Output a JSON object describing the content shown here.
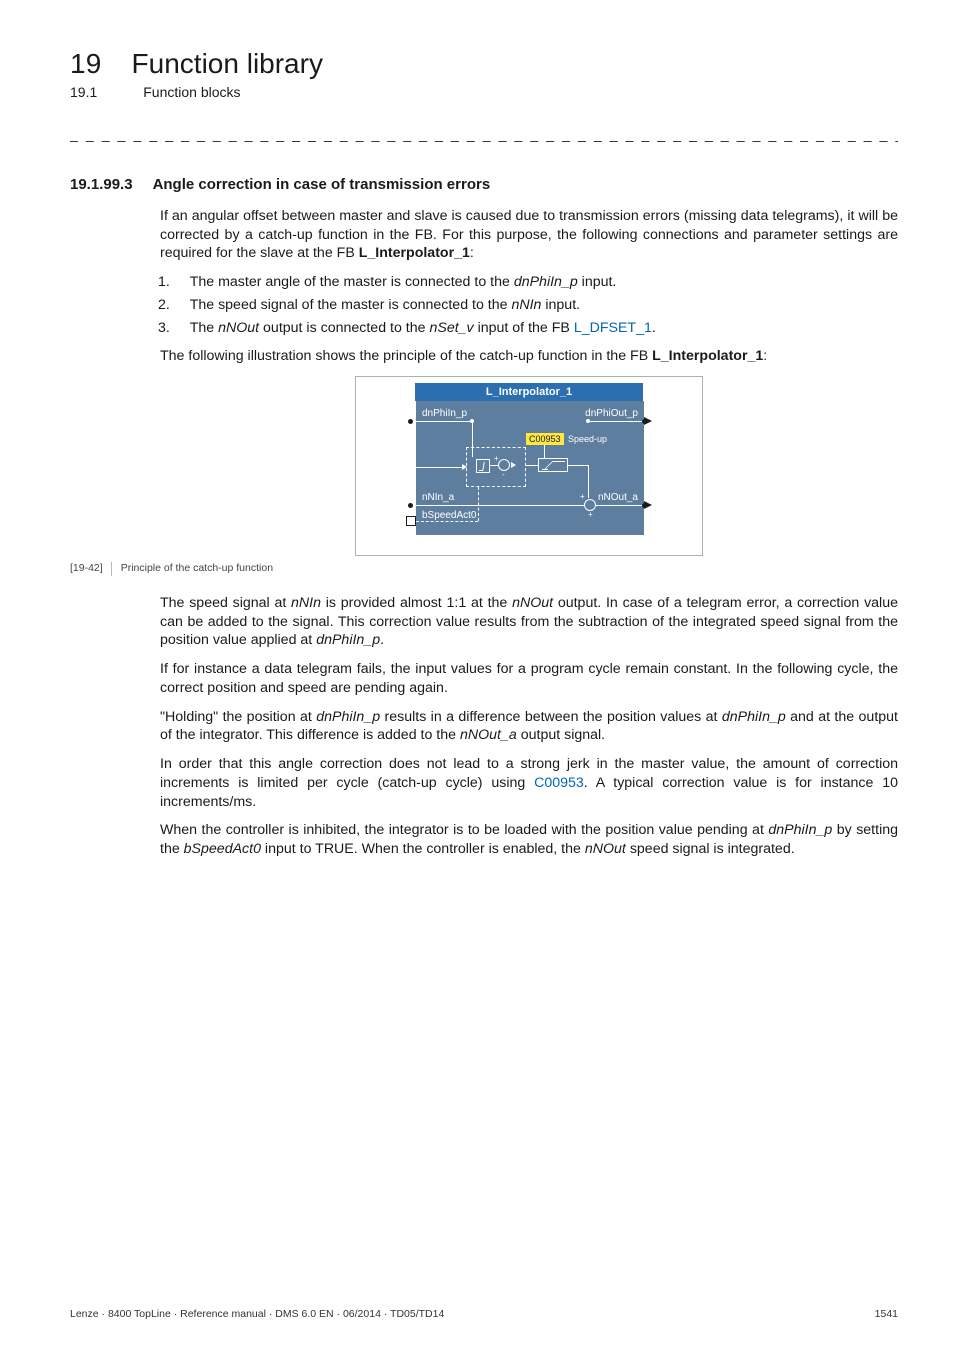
{
  "header": {
    "chapter_num": "19",
    "chapter_title": "Function library",
    "section_num": "19.1",
    "section_title": "Function blocks"
  },
  "dashline": "_ _ _ _ _ _ _ _ _ _ _ _ _ _ _ _ _ _ _ _ _ _ _ _ _ _ _ _ _ _ _ _ _ _ _ _ _ _ _ _ _ _ _ _ _ _ _ _ _ _ _ _ _ _ _ _ _ _ _ _ _ _ _ _",
  "section": {
    "number": "19.1.99.3",
    "title": "Angle correction in case of transmission errors"
  },
  "intro": {
    "p1_a": "If an angular offset between master and slave is caused due to transmission errors (missing data telegrams), it will be corrected by a catch-up function in the FB. For this purpose, the following connections and parameter settings are required for the slave at the FB ",
    "p1_b_bold": "L_Interpolator_1",
    "p1_c": ":"
  },
  "steps": {
    "s1_a": "The master angle of the master is connected to the ",
    "s1_i": "dnPhiIn_p",
    "s1_b": " input.",
    "s2_a": "The speed signal of the master is connected to the ",
    "s2_i": "nNIn",
    "s2_b": " input.",
    "s3_a": "The ",
    "s3_i1": "nNOut",
    "s3_b": " output is connected to the ",
    "s3_i2": "nSet_v",
    "s3_c": " input of the FB ",
    "s3_link": "L_DFSET_1",
    "s3_d": "."
  },
  "lead2_a": "The following illustration shows the principle of the catch-up function in the FB ",
  "lead2_b_bold": "L_Interpolator_1",
  "lead2_c": ":",
  "chart_data": {
    "type": "diagram",
    "title": "L_Interpolator_1",
    "inputs": [
      "dnPhiIn_p",
      "nNIn_a",
      "bSpeedAct0"
    ],
    "outputs": [
      "dnPhiOut_p",
      "nNOut_a"
    ],
    "param_code": "C00953",
    "param_label": "Speed-up",
    "ports": {
      "dnPhiIn_p": "dnPhiIn_p",
      "dnPhiOut_p": "dnPhiOut_p",
      "nNIn_a": "nNIn_a",
      "nNOut_a": "nNOut_a",
      "bSpeedAct0": "bSpeedAct0"
    }
  },
  "caption": {
    "tag": "[19-42]",
    "text": "Principle of the catch-up function"
  },
  "after": {
    "p1_a": "The speed signal at ",
    "p1_i1": "nNIn",
    "p1_b": " is provided almost 1:1 at the ",
    "p1_i2": "nNOut",
    "p1_c": " output. In case of a telegram error, a correction value can be added to the signal. This correction value results from the subtraction of the integrated speed signal from the position value applied at ",
    "p1_i3": "dnPhiIn_p",
    "p1_d": ".",
    "p2": "If for instance a data telegram fails, the input values for a program cycle remain constant. In the following cycle, the correct position and speed are pending again.",
    "p3_a": "\"Holding\" the position at ",
    "p3_i1": "dnPhiIn_p",
    "p3_b": " results in a difference between the position values at ",
    "p3_i2": "dnPhiIn_p",
    "p3_c": " and at the output of the integrator. This difference is added to the ",
    "p3_i3": "nNOut_a",
    "p3_d": " output signal.",
    "p4_a": "In order that this angle correction does not lead to a strong jerk in the master value, the amount of correction increments is limited per cycle (catch-up cycle) using ",
    "p4_link": "C00953",
    "p4_b": ". A typical correction value is for instance 10 increments/ms.",
    "p5_a": "When the controller is inhibited, the integrator is to be loaded with the position value pending at ",
    "p5_i1": "dnPhiIn_p",
    "p5_b": "  by setting the ",
    "p5_i2": "bSpeedAct0",
    "p5_c": " input to TRUE. When the controller is enabled, the ",
    "p5_i3": "nNOut",
    "p5_d": " speed signal is integrated."
  },
  "footer": {
    "left": "Lenze · 8400 TopLine · Reference manual · DMS 6.0 EN · 06/2014 · TD05/TD14",
    "right": "1541"
  }
}
